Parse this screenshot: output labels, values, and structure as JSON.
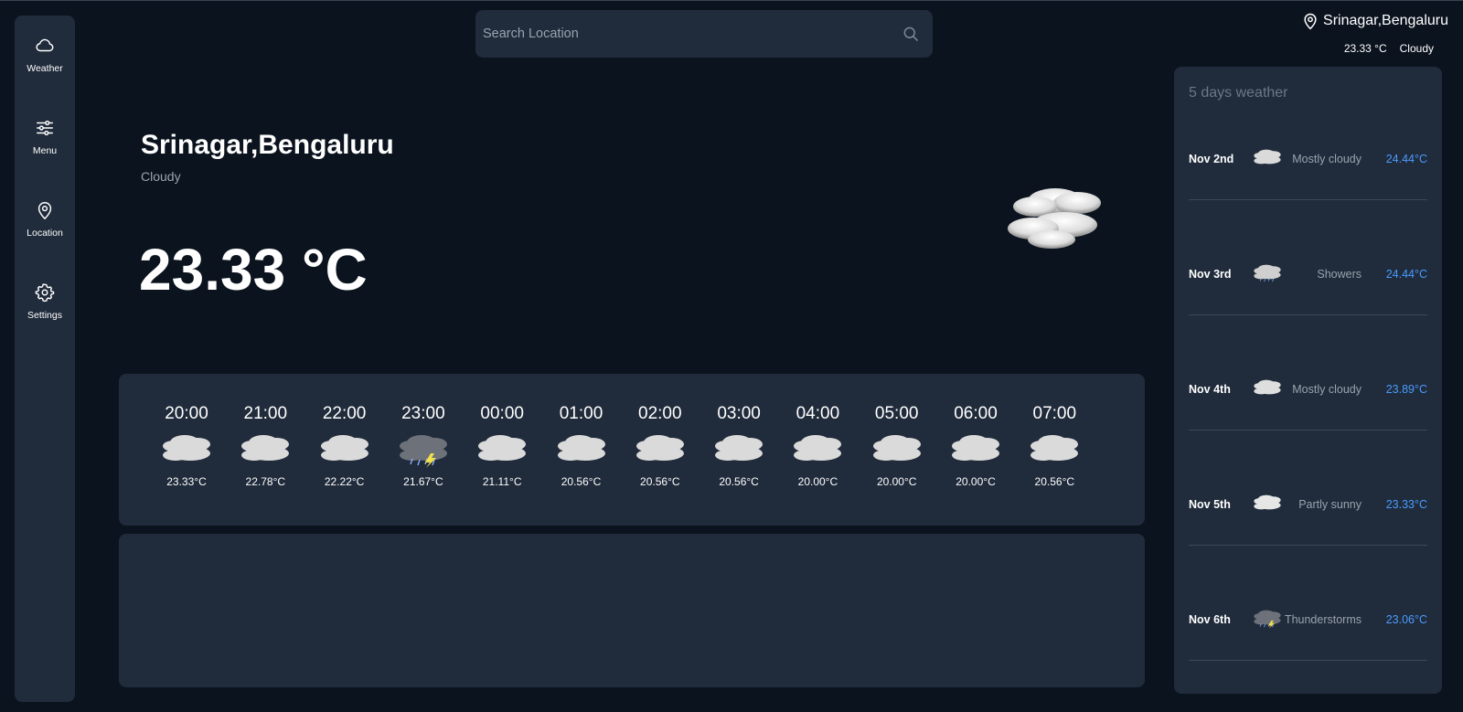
{
  "colors": {
    "background": "#0b131e",
    "panel": "#202b3b",
    "accent": "#4a9cff",
    "muted": "#9aa3ae"
  },
  "sidebar": {
    "items": [
      {
        "label": "Weather",
        "icon": "cloud-icon"
      },
      {
        "label": "Menu",
        "icon": "sliders-icon"
      },
      {
        "label": "Location",
        "icon": "map-pin-icon"
      },
      {
        "label": "Settings",
        "icon": "gear-icon"
      }
    ]
  },
  "search": {
    "placeholder": "Search Location",
    "value": ""
  },
  "summary": {
    "location": "Srinagar,Bengaluru",
    "temp": "23.33 °C",
    "condition": "Cloudy"
  },
  "current": {
    "city": "Srinagar,Bengaluru",
    "condition": "Cloudy",
    "temp": "23.33 °C",
    "icon": "cloudy-icon"
  },
  "hourly": [
    {
      "time": "20:00",
      "temp": "23.33°C",
      "icon": "cloudy-icon"
    },
    {
      "time": "21:00",
      "temp": "22.78°C",
      "icon": "cloudy-icon"
    },
    {
      "time": "22:00",
      "temp": "22.22°C",
      "icon": "cloudy-icon"
    },
    {
      "time": "23:00",
      "temp": "21.67°C",
      "icon": "thunderstorm-icon"
    },
    {
      "time": "00:00",
      "temp": "21.11°C",
      "icon": "cloudy-icon"
    },
    {
      "time": "01:00",
      "temp": "20.56°C",
      "icon": "cloudy-icon"
    },
    {
      "time": "02:00",
      "temp": "20.56°C",
      "icon": "cloudy-icon"
    },
    {
      "time": "03:00",
      "temp": "20.56°C",
      "icon": "cloudy-icon"
    },
    {
      "time": "04:00",
      "temp": "20.00°C",
      "icon": "cloudy-icon"
    },
    {
      "time": "05:00",
      "temp": "20.00°C",
      "icon": "cloudy-icon"
    },
    {
      "time": "06:00",
      "temp": "20.00°C",
      "icon": "cloudy-icon"
    },
    {
      "time": "07:00",
      "temp": "20.56°C",
      "icon": "cloudy-icon"
    }
  ],
  "forecast": {
    "title": "5 days weather",
    "days": [
      {
        "date": "Nov 2nd",
        "condition": "Mostly cloudy",
        "temp": "24.44°C",
        "icon": "mostly-cloudy-icon"
      },
      {
        "date": "Nov 3rd",
        "condition": "Showers",
        "temp": "24.44°C",
        "icon": "showers-icon"
      },
      {
        "date": "Nov 4th",
        "condition": "Mostly cloudy",
        "temp": "23.89°C",
        "icon": "mostly-cloudy-sun-icon"
      },
      {
        "date": "Nov 5th",
        "condition": "Partly sunny",
        "temp": "23.33°C",
        "icon": "partly-sunny-icon"
      },
      {
        "date": "Nov 6th",
        "condition": "Thunderstorms",
        "temp": "23.06°C",
        "icon": "thunderstorm-icon"
      }
    ]
  }
}
